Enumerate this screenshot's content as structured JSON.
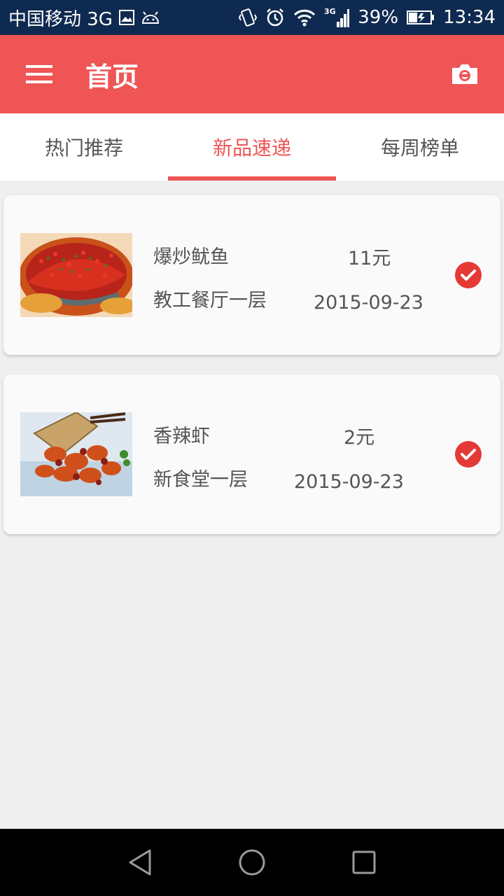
{
  "status_bar": {
    "carrier": "中国移动 3G",
    "network": "3G",
    "battery": "39%",
    "time": "13:34",
    "icons": [
      "image-icon",
      "android-icon",
      "vibrate-icon",
      "alarm-icon",
      "wifi-icon",
      "signal-icon",
      "battery-icon"
    ]
  },
  "app_bar": {
    "title": "首页",
    "menu_icon": "menu-icon",
    "camera_icon": "camera-icon"
  },
  "tabs": [
    {
      "label": "热门推荐",
      "active": false
    },
    {
      "label": "新品速递",
      "active": true
    },
    {
      "label": "每周榜单",
      "active": false
    }
  ],
  "items": [
    {
      "name": "爆炒鱿鱼",
      "location": "教工餐厅一层",
      "price": "11元",
      "date": "2015-09-23",
      "checked": true
    },
    {
      "name": "香辣虾",
      "location": "新食堂一层",
      "price": "2元",
      "date": "2015-09-23",
      "checked": true
    }
  ],
  "colors": {
    "accent": "#ef5555",
    "status_bar": "#0f2a50",
    "check": "#e53935"
  },
  "nav_bar": {
    "icons": [
      "back-icon",
      "home-icon",
      "recents-icon"
    ]
  }
}
